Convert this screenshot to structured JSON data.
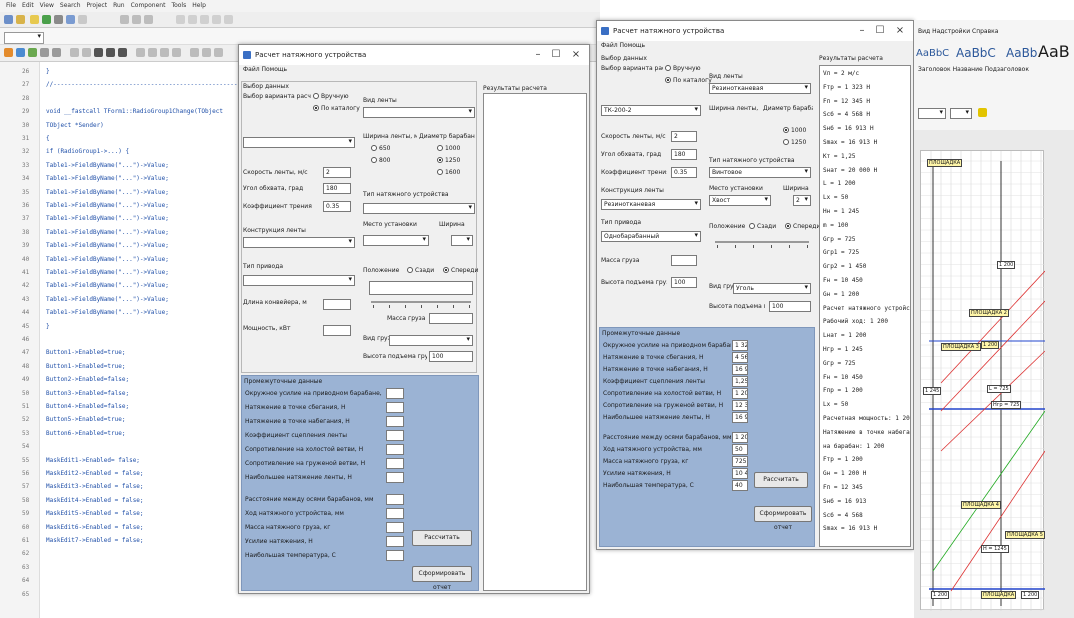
{
  "ide": {
    "menu": [
      "File",
      "Edit",
      "View",
      "Search",
      "Project",
      "Run",
      "Component",
      "Tools",
      "Help"
    ],
    "combo_value": "",
    "line_numbers": [
      "26",
      "27",
      "28",
      "29",
      "30",
      "31",
      "32",
      "33",
      "34",
      "35",
      "36",
      "37",
      "38",
      "39",
      "40",
      "41",
      "42",
      "43",
      "44",
      "45",
      "46",
      "47",
      "48",
      "49",
      "50",
      "51",
      "52",
      "53",
      "54",
      "55",
      "56",
      "57",
      "58",
      "59",
      "60",
      "61",
      "62",
      "63",
      "64",
      "65"
    ],
    "code_lines": [
      {
        "line": "26",
        "text": "  }"
      },
      {
        "line": "27",
        "text": "  //-----------------------------------------------------"
      },
      {
        "line": "29",
        "text": "void __fastcall TForm1::RadioGroup1Change(TObject"
      },
      {
        "line": "30",
        "text": "     TObject *Sender)"
      },
      {
        "line": "31",
        "text": "{"
      },
      {
        "line": "32",
        "text": "  if (RadioGroup1->...) {"
      },
      {
        "line": "33",
        "text": "  Table1->FieldByName(\"...\")->Value;"
      },
      {
        "line": "34",
        "text": "  Table1->FieldByName(\"...\")->Value;"
      },
      {
        "line": "35",
        "text": "  Table1->FieldByName(\"...\")->Value;"
      },
      {
        "line": "36",
        "text": "  Table1->FieldByName(\"...\")->Value;"
      },
      {
        "line": "37",
        "text": "  Table1->FieldByName(\"...\")->Value;"
      },
      {
        "line": "38",
        "text": "  Table1->FieldByName(\"...\")->Value;"
      },
      {
        "line": "39",
        "text": "  Table1->FieldByName(\"...\")->Value;"
      },
      {
        "line": "40",
        "text": "  Table1->FieldByName(\"...\")->Value;"
      },
      {
        "line": "41",
        "text": "  Table1->FieldByName(\"...\")->Value;"
      },
      {
        "line": "42",
        "text": "  Table1->FieldByName(\"...\")->Value;"
      },
      {
        "line": "43",
        "text": "  Table1->FieldByName(\"...\")->Value;"
      },
      {
        "line": "44",
        "text": "  Table1->FieldByName(\"...\")->Value;"
      },
      {
        "line": "45",
        "text": "}"
      },
      {
        "line": "47",
        "text": "      Button1->Enabled=true;"
      },
      {
        "line": "48",
        "text": "  Button1->Enabled=true;"
      },
      {
        "line": "49",
        "text": "  Button2->Enabled=false;"
      },
      {
        "line": "50",
        "text": "  Button3->Enabled=false;"
      },
      {
        "line": "51",
        "text": "  Button4->Enabled=false;"
      },
      {
        "line": "52",
        "text": "      Button5->Enabled=true;"
      },
      {
        "line": "53",
        "text": "  Button6->Enabled=true;"
      },
      {
        "line": "55",
        "text": "  MaskEdit1->Enabled= false;"
      },
      {
        "line": "56",
        "text": "  MaskEdit2->Enabled = false;"
      },
      {
        "line": "57",
        "text": "     MaskEdit3->Enabled = false;"
      },
      {
        "line": "58",
        "text": "       MaskEdit4->Enabled = false;"
      },
      {
        "line": "59",
        "text": "       MaskEdit5->Enabled = false;"
      },
      {
        "line": "60",
        "text": "       MaskEdit6->Enabled = false;"
      },
      {
        "line": "61",
        "text": "       MaskEdit7->Enabled = false;"
      }
    ]
  },
  "dialog1": {
    "title": "Расчет натяжного устройства",
    "menu": "Файл   Помощь",
    "section_source": "Выбор данных",
    "calc_type_label": "Выбор варианта расчета",
    "radio_calc_a": "Вручную",
    "radio_calc_b": "По каталогу",
    "belt_label": "Вид ленты",
    "belt_width_label": "Ширина ленты, мм",
    "drum_label": "Диаметр барабана, мм",
    "belt_width_opts": [
      "650",
      "800"
    ],
    "drum_opts": [
      "1000",
      "1250",
      "1600"
    ],
    "speed_label": "Скорость ленты, м/с",
    "speed_value": "2",
    "angle_label": "Угол обхвата, град",
    "angle_value": "180",
    "coef_label": "Коэффициент трения",
    "coef_value": "0.35",
    "conveyor_label": "Конструкция ленты",
    "drive_label": "Тип привода",
    "tension_label": "Тип натяжного устройства",
    "tension_hint": "Место установки",
    "position_label": "Положение",
    "position_opt_a": "Сзади",
    "position_opt_b": "Спереди",
    "cargo_label": "Вид груза",
    "length_label": "Длина конвейера, м",
    "length_value": "",
    "width_label": "Ширина",
    "height_label": "Высота подъема груза, м",
    "height_value": "100",
    "weight_label": "Масса груза",
    "weight_value": "",
    "power_label": "Мощность, кВт",
    "power_value": "",
    "results_title": "Результаты расчета",
    "blue_title": "Промежуточные данные",
    "blue_rows": [
      "Окружное усилие на приводном барабане, Н",
      "Натяжение в точке сбегания, Н",
      "Натяжение в точке набегания, Н",
      "Коэффициент сцепления ленты",
      "Сопротивление на холостой ветви, Н",
      "Сопротивление на груженой ветви, Н",
      "Наибольшее натяжение ленты, Н",
      "Расстояние между осями барабанов, мм",
      "Ход натяжного устройства, мм",
      "Масса натяжного груза, кг",
      "Усилие натяжения, Н",
      "Наибольшая температура, С"
    ],
    "button_calc": "Рассчитать",
    "button_report": "Сформировать отчет"
  },
  "dialog2": {
    "title": "Расчет натяжного устройства",
    "menu": "Файл   Помощь",
    "section_source": "Выбор данных",
    "calc_type_label": "Выбор варианта расчета",
    "radio_calc_a": "Вручную",
    "radio_calc_b": "По каталогу",
    "belt_label": "Вид ленты",
    "belt_value": "Резинотканевая",
    "belt_width_label": "Ширина ленты, мм",
    "drum_label": "Диаметр барабана, мм",
    "drum_opts": [
      "1000",
      "1250"
    ],
    "model_value": "ТК-200-2",
    "speed_label": "Скорость ленты, м/с",
    "speed_value": "2",
    "angle_label": "Угол обхвата, град",
    "angle_value": "180",
    "coef_label": "Коэффициент трения",
    "coef_value": "0.35",
    "tension_label": "Тип натяжного устройства",
    "tension_value": "Винтовое",
    "conveyor_label": "Конструкция ленты",
    "conveyor_value": "Резинотканевая",
    "drive_label": "Тип привода",
    "drive_value": "Однобарабанный",
    "place_label": "Место установки",
    "place_value": "Хвост",
    "width_label": "Ширина",
    "width_value": "2",
    "position_label": "Положение",
    "position_opt_a": "Сзади",
    "position_opt_b": "Спереди",
    "cargo_label": "Вид груза",
    "cargo_value": "Уголь",
    "weight_label": "Масса груза",
    "weight_value": "",
    "height_label": "Высота подъема груза, м",
    "height_value": "100",
    "results_title": "Результаты расчета",
    "results_lines": [
      "Vл = 2 м/с",
      "Fтр = 1 323 Н",
      "Fп = 12 345 Н",
      "Sсб = 4 568 Н",
      "Sнб = 16 913 Н",
      "Smax = 16 913 Н",
      "Кт = 1,25",
      "Sнат = 20 000 Н",
      "L = 1 200",
      "Lх = 50",
      "Hн = 1 245",
      "m = 100",
      "Gгр = 725",
      "Gгр1 = 725",
      "Gгр2 = 1 450",
      "Fн = 10 450",
      "Gн = 1 200",
      "Расчет натяжного устройства:",
      "Рабочий ход: 1 200",
      "Lнат = 1 200",
      "Hгр = 1 245",
      "Gгр = 725",
      "Fн = 10 450",
      "Fпр = 1 200",
      "Lх = 50",
      "Расчетная мощность: 1 200",
      "Натяжение в точке набегания",
      "на барабан: 1 200",
      "Fтр = 1 200",
      "Gн = 1 200 Н",
      "Fп = 12 345",
      "Sнб = 16 913",
      "Sсб = 4 568",
      "Smax = 16 913 Н"
    ],
    "blue_title": "Промежуточные данные",
    "blue_rows": [
      {
        "label": "Окружное усилие на приводном барабане, Н",
        "value": "1 323"
      },
      {
        "label": "Натяжение в точке сбегания, Н",
        "value": "4 568"
      },
      {
        "label": "Натяжение в точке набегания, Н",
        "value": "16 913"
      },
      {
        "label": "Коэффициент сцепления ленты",
        "value": "1,25"
      },
      {
        "label": "Сопротивление на холостой ветви, Н",
        "value": "1 200"
      },
      {
        "label": "Сопротивление на груженой ветви, Н",
        "value": "12 345"
      },
      {
        "label": "Наибольшее натяжение ленты, Н",
        "value": "16 913"
      },
      {
        "label": "Расстояние между осями барабанов, мм",
        "value": "1 200"
      },
      {
        "label": "Ход натяжного устройства, мм",
        "value": "50"
      },
      {
        "label": "Масса натяжного груза, кг",
        "value": "725"
      },
      {
        "label": "Усилие натяжения, Н",
        "value": "10 450"
      },
      {
        "label": "Наибольшая температура, С",
        "value": "40"
      }
    ],
    "button_calc": "Рассчитать",
    "button_report": "Сформировать отчет"
  },
  "word": {
    "ribbon_tabs": "Вид   Надстройки   Справка",
    "styles": [
      "AaBbC",
      "AaBbC",
      "AaBb",
      "AaB"
    ],
    "style_names": "Заголовок  Название  Подзаголовок",
    "diagram_tags": [
      {
        "text": "ПЛОЩАДКА",
        "style": "yellow"
      },
      {
        "text": "1 200",
        "style": "white"
      },
      {
        "text": "ПЛОЩАДКА 2",
        "style": "yellow"
      },
      {
        "text": "1 200",
        "style": "yellow"
      },
      {
        "text": "ПЛОЩАДКА 3",
        "style": "yellow"
      },
      {
        "text": "L = 725",
        "style": "white"
      },
      {
        "text": "1 245",
        "style": "white"
      },
      {
        "text": "Hгр = 725",
        "style": "white"
      },
      {
        "text": "ПЛОЩАДКА 4",
        "style": "yellow"
      },
      {
        "text": "H = 1245",
        "style": "white"
      },
      {
        "text": "ПЛОЩАДКА 5",
        "style": "yellow"
      },
      {
        "text": "1 200",
        "style": "white"
      },
      {
        "text": "ПЛОЩАДКА",
        "style": "yellow"
      },
      {
        "text": "1 200",
        "style": "white"
      }
    ]
  }
}
